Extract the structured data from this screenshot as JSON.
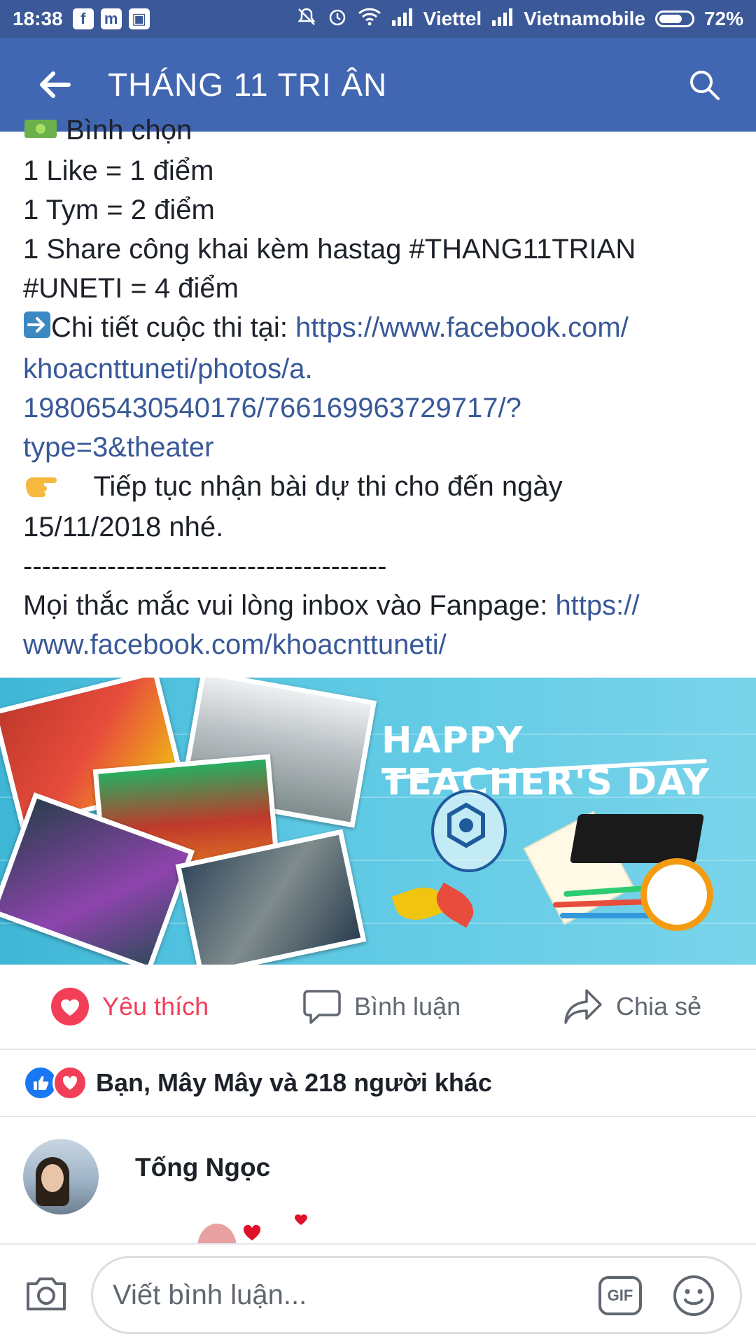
{
  "status_bar": {
    "time": "18:38",
    "carrier1": "Viettel",
    "carrier2": "Vietnamobile",
    "battery": "72%",
    "battery_level": 0.72
  },
  "header": {
    "title": "THÁNG 11 TRI ÂN",
    "back_icon": "arrow-left-icon",
    "search_icon": "search-icon"
  },
  "post": {
    "lines": [
      {
        "text": "Bình chọn",
        "emoji": "money-icon"
      },
      {
        "text": "1 Like = 1 điểm"
      },
      {
        "text": "1 Tym = 2 điểm"
      },
      {
        "text": "1 Share công khai kèm hastag  #THANG11TRIAN"
      },
      {
        "text": "#UNETI  = 4 điểm"
      }
    ],
    "detail_prefix": "Chi tiết cuộc thi tại: ",
    "detail_link_1": "https://www.facebook.com/",
    "detail_link_2": "khoacnttuneti/photos/a.",
    "detail_link_3": "198065430540176/766169963729717/?",
    "detail_link_4": "type=3&theater",
    "continue_1": "Tiếp tục nhận bài dự thi cho đến ngày",
    "continue_2": "15/11/2018 nhé.",
    "divider": "---------------------------------------",
    "inbox_prefix": "Mọi thắc mắc vui lòng inbox vào Fanpage: ",
    "inbox_link_1": "https://",
    "inbox_link_2": "www.facebook.com/khoacnttuneti/"
  },
  "banner": {
    "headline": "HAPPY TEACHER'S DAY"
  },
  "actions": {
    "like_label": "Yêu thích",
    "comment_label": "Bình luận",
    "share_label": "Chia sẻ"
  },
  "reactions": {
    "summary": "Bạn, Mây Mây và 218 người khác"
  },
  "comment": {
    "author": "Tống Ngọc"
  },
  "composer": {
    "placeholder": "Viết bình luận...",
    "gif_label": "GIF"
  },
  "colors": {
    "header_bg": "#4267b2",
    "statusbar_bg": "#3b5998",
    "link": "#385898",
    "love": "#f33e58"
  }
}
